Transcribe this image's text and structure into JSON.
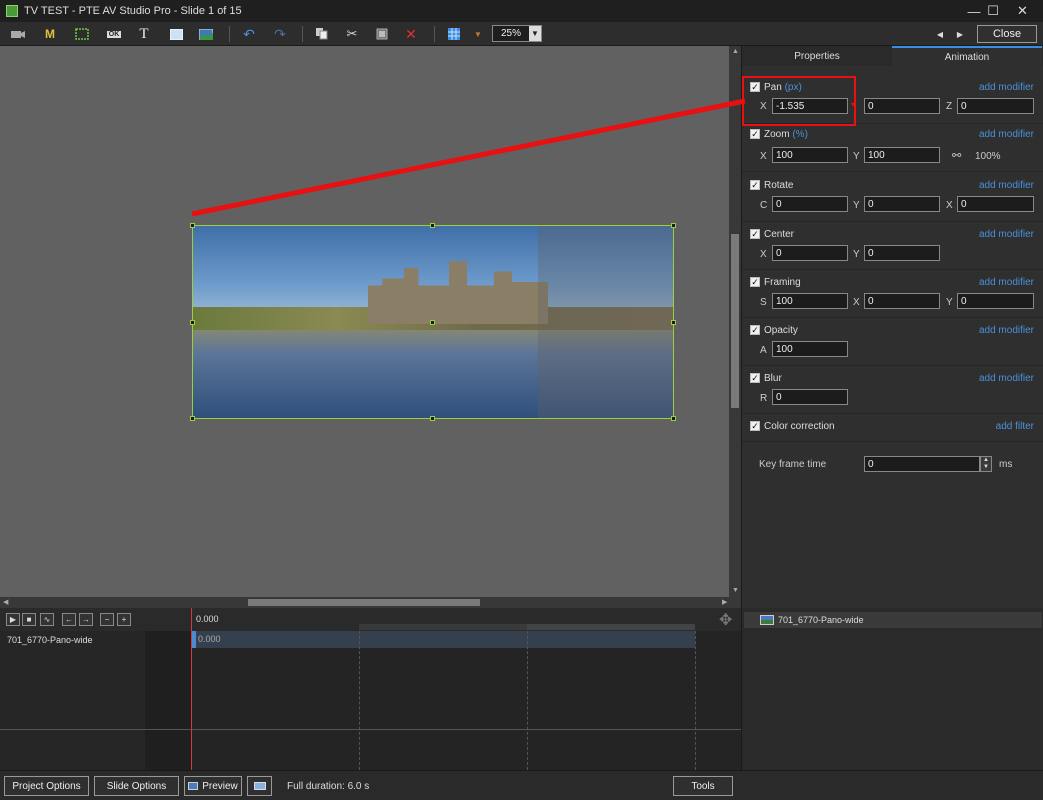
{
  "window": {
    "title": "TV TEST - PTE AV Studio Pro - Slide 1 of 15",
    "minimize": "—",
    "maximize": "☐",
    "close": "✕"
  },
  "toolbar": {
    "m_label": "M",
    "ok_label": "OK",
    "t_label": "T",
    "zoom_value": "25%",
    "close_label": "Close"
  },
  "tabs": {
    "properties": "Properties",
    "animation": "Animation"
  },
  "animation": {
    "pan": {
      "label": "Pan",
      "unit": "(px)",
      "add": "add modifier",
      "x": "-1.535",
      "y": "0",
      "z": "0"
    },
    "zoom": {
      "label": "Zoom",
      "unit": "(%)",
      "add": "add modifier",
      "x": "100",
      "y": "100",
      "link_value": "100%"
    },
    "rotate": {
      "label": "Rotate",
      "add": "add modifier",
      "c": "0",
      "y": "0",
      "x": "0"
    },
    "center": {
      "label": "Center",
      "add": "add modifier",
      "x": "0",
      "y": "0"
    },
    "framing": {
      "label": "Framing",
      "add": "add modifier",
      "s": "100",
      "x": "0",
      "y": "0"
    },
    "opacity": {
      "label": "Opacity",
      "add": "add modifier",
      "a": "100"
    },
    "blur": {
      "label": "Blur",
      "add": "add modifier",
      "r": "0"
    },
    "color": {
      "label": "Color correction",
      "add": "add filter"
    },
    "keyframe": {
      "label": "Key frame time",
      "value": "0",
      "unit": "ms"
    }
  },
  "field_letters": {
    "x": "X",
    "y": "Y",
    "z": "Z",
    "c": "C",
    "s": "S",
    "a": "A",
    "r": "R"
  },
  "timeline": {
    "ruler_time": "0.000",
    "clip_time": "0.000",
    "track_name": "701_6770-Pano-wide"
  },
  "object_list": {
    "item": "701_6770-Pano-wide"
  },
  "bottom": {
    "project_options": "Project Options",
    "slide_options": "Slide Options",
    "preview": "Preview",
    "duration": "Full duration: 6.0 s",
    "tools": "Tools"
  },
  "colors": {
    "accent": "#3a8ee6",
    "link": "#4a90d9",
    "selection": "#9ccf3c",
    "annotation": "#e81010"
  }
}
